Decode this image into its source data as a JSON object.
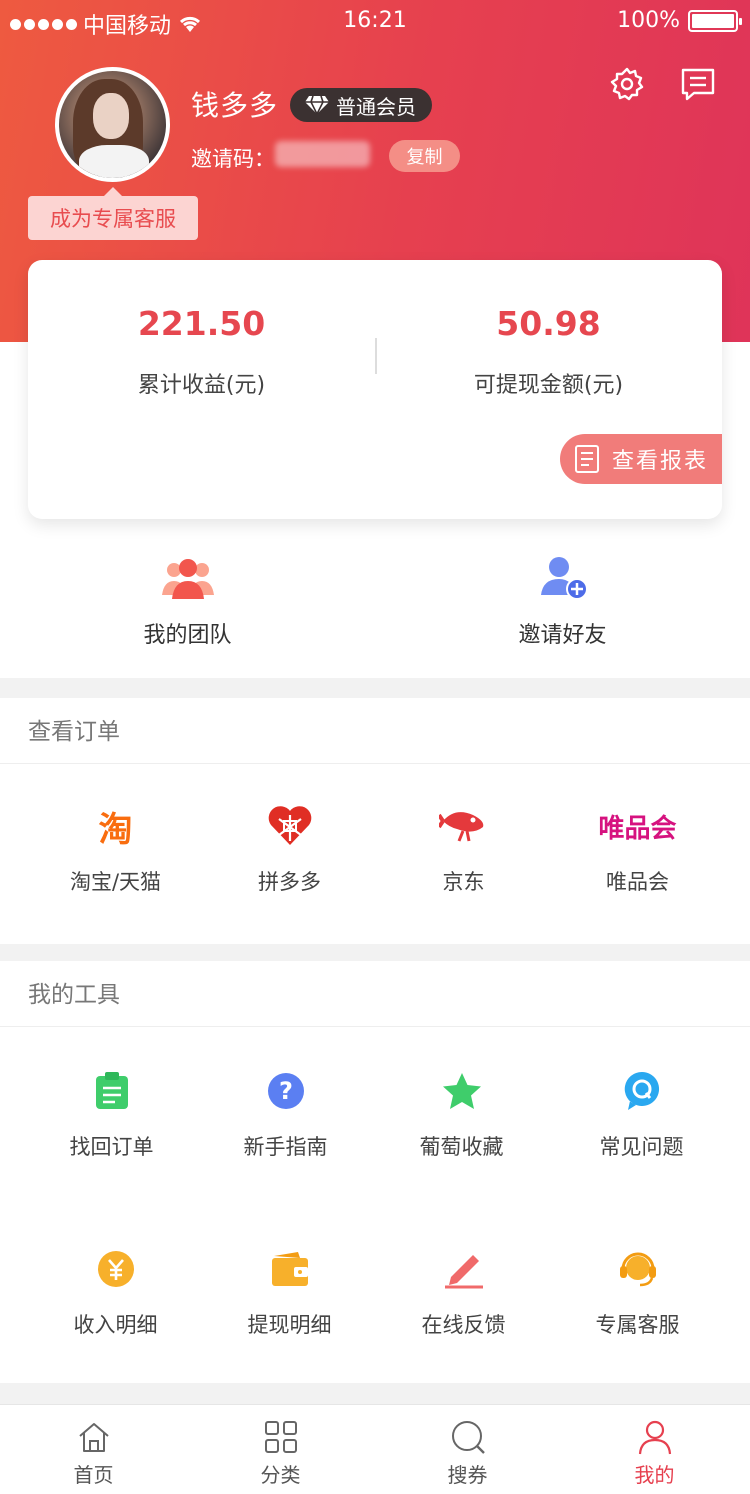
{
  "status_bar": {
    "carrier": "中国移动",
    "time": "16:21",
    "battery": "100%"
  },
  "profile": {
    "username": "钱多多",
    "member_level": "普通会员",
    "invite_label": "邀请码：",
    "copy_label": "复制",
    "tag": "成为专属客服"
  },
  "stats": {
    "total_income_value": "221.50",
    "total_income_label": "累计收益(元)",
    "withdrawable_value": "50.98",
    "withdrawable_label": "可提现金额(元)",
    "report_label": "查看报表"
  },
  "quick_actions": [
    {
      "label": "我的团队",
      "icon": "team-icon"
    },
    {
      "label": "邀请好友",
      "icon": "add-user-icon"
    }
  ],
  "orders": {
    "title": "查看订单",
    "items": [
      {
        "label": "淘宝/天猫",
        "icon_text": "淘",
        "color": "#f96d0f"
      },
      {
        "label": "拼多多",
        "icon": "pinduoduo-icon",
        "color": "#e02e24"
      },
      {
        "label": "京东",
        "icon": "jd-icon",
        "color": "#e4393c"
      },
      {
        "label": "唯品会",
        "icon_text": "唯品会",
        "color": "#d6127f"
      }
    ]
  },
  "tools": {
    "title": "我的工具",
    "items": [
      {
        "label": "找回订单",
        "icon": "clipboard-icon",
        "color": "#3fcd6b"
      },
      {
        "label": "新手指南",
        "icon": "help-icon",
        "color": "#5b7ff2"
      },
      {
        "label": "葡萄收藏",
        "icon": "star-icon",
        "color": "#3fcd6b"
      },
      {
        "label": "常见问题",
        "icon": "faq-icon",
        "color": "#2aa8f0"
      },
      {
        "label": "收入明细",
        "icon": "yuan-icon",
        "color": "#f7b02b"
      },
      {
        "label": "提现明细",
        "icon": "wallet-icon",
        "color": "#f7b02b"
      },
      {
        "label": "在线反馈",
        "icon": "feedback-icon",
        "color": "#f06a6a"
      },
      {
        "label": "专属客服",
        "icon": "headset-icon",
        "color": "#f7b02b"
      }
    ]
  },
  "tabbar": {
    "items": [
      {
        "label": "首页",
        "icon": "home-icon"
      },
      {
        "label": "分类",
        "icon": "category-icon"
      },
      {
        "label": "搜券",
        "icon": "search-icon"
      },
      {
        "label": "我的",
        "icon": "profile-icon"
      }
    ],
    "active_index": 3,
    "active_color": "#e6404f"
  },
  "colors": {
    "brand_start": "#ee5a40",
    "brand_end": "#df3459",
    "accent": "#e6474f"
  }
}
